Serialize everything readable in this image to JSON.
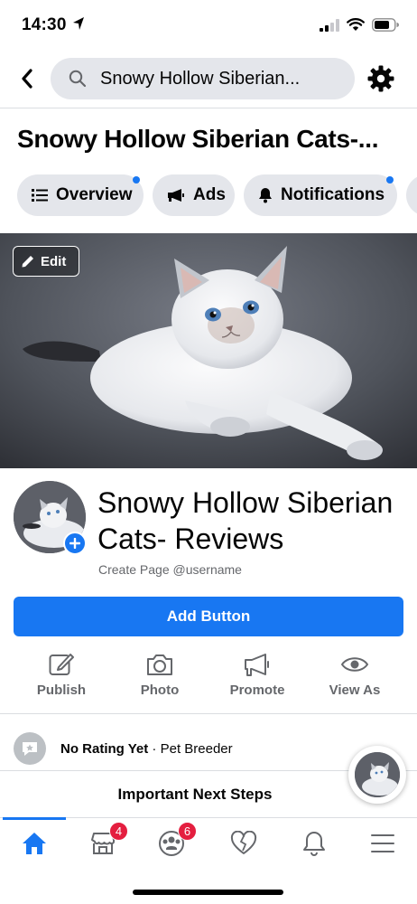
{
  "status_bar": {
    "time": "14:30"
  },
  "nav": {
    "search_text": "Snowy Hollow Siberian..."
  },
  "page": {
    "title": "Snowy Hollow Siberian Cats-...",
    "name": "Snowy Hollow Siberian Cats- Reviews",
    "create_handle": "Create Page @username"
  },
  "tabs": [
    {
      "label": "Overview",
      "icon": "list-icon",
      "has_dot": true
    },
    {
      "label": "Ads",
      "icon": "megaphone-icon",
      "has_dot": false
    },
    {
      "label": "Notifications",
      "icon": "bell-icon",
      "has_dot": true
    }
  ],
  "cover": {
    "edit_label": "Edit"
  },
  "add_button": {
    "label": "Add Button"
  },
  "actions": [
    {
      "label": "Publish",
      "icon": "edit-icon"
    },
    {
      "label": "Photo",
      "icon": "camera-icon"
    },
    {
      "label": "Promote",
      "icon": "megaphone-icon"
    },
    {
      "label": "View As",
      "icon": "eye-icon"
    }
  ],
  "rating": {
    "status": "No Rating Yet",
    "separator": " · ",
    "category": "Pet Breeder"
  },
  "next_steps": {
    "label": "Important Next Steps"
  },
  "bottom_nav": {
    "items": [
      {
        "icon": "home-icon",
        "badge": ""
      },
      {
        "icon": "marketplace-icon",
        "badge": "4"
      },
      {
        "icon": "groups-icon",
        "badge": "6"
      },
      {
        "icon": "dating-icon",
        "badge": ""
      },
      {
        "icon": "bell-icon",
        "badge": ""
      },
      {
        "icon": "menu-icon",
        "badge": ""
      }
    ]
  },
  "colors": {
    "accent": "#1877f2",
    "badge": "#e41e3f",
    "surface": "#e4e6eb",
    "secondary_text": "#65676b"
  }
}
